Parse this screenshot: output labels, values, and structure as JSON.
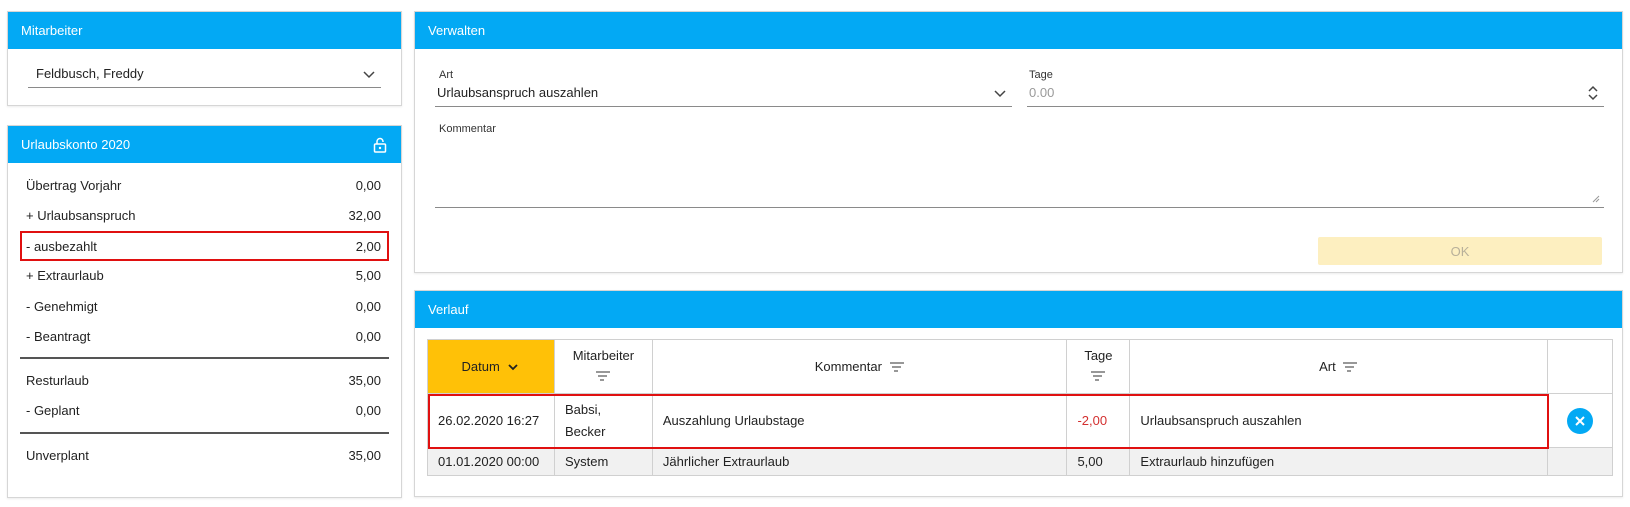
{
  "employee_panel": {
    "title": "Mitarbeiter",
    "selected_employee": "Feldbusch, Freddy"
  },
  "account_panel": {
    "title": "Urlaubskonto 2020",
    "rows": [
      {
        "label": "Übertrag Vorjahr",
        "value": "0,00"
      },
      {
        "label": "+ Urlaubsanspruch",
        "value": "32,00"
      },
      {
        "label": "- ausbezahlt",
        "value": "2,00"
      },
      {
        "label": "+ Extraurlaub",
        "value": "5,00"
      },
      {
        "label": "- Genehmigt",
        "value": "0,00"
      },
      {
        "label": "- Beantragt",
        "value": "0,00"
      },
      {
        "label": "Resturlaub",
        "value": "35,00"
      },
      {
        "label": "- Geplant",
        "value": "0,00"
      },
      {
        "label": "Unverplant",
        "value": "35,00"
      }
    ]
  },
  "manage_panel": {
    "title": "Verwalten",
    "art_label": "Art",
    "art_value": "Urlaubsanspruch auszahlen",
    "tage_label": "Tage",
    "tage_placeholder": "0.00",
    "comment_label": "Kommentar",
    "ok_label": "OK"
  },
  "history_panel": {
    "title": "Verlauf",
    "columns": {
      "datum": "Datum",
      "mitarbeiter": "Mitarbeiter",
      "kommentar": "Kommentar",
      "tage": "Tage",
      "art": "Art"
    },
    "rows": [
      {
        "datum": "26.02.2020 16:27",
        "mitarbeiter_line1": "Babsi,",
        "mitarbeiter_line2": "Becker",
        "kommentar": "Auszahlung Urlaubstage",
        "tage": "-2,00",
        "art": "Urlaubsanspruch auszahlen"
      },
      {
        "datum": "01.01.2020 00:00",
        "mitarbeiter": "System",
        "kommentar": "Jährlicher Extraurlaub",
        "tage": "5,00",
        "art": "Extraurlaub hinzufügen"
      }
    ]
  },
  "colors": {
    "header_blue": "#03a9f4",
    "sorted_column": "#ffc107",
    "highlight_red": "#e01010",
    "negative_value": "#d32f2f"
  }
}
